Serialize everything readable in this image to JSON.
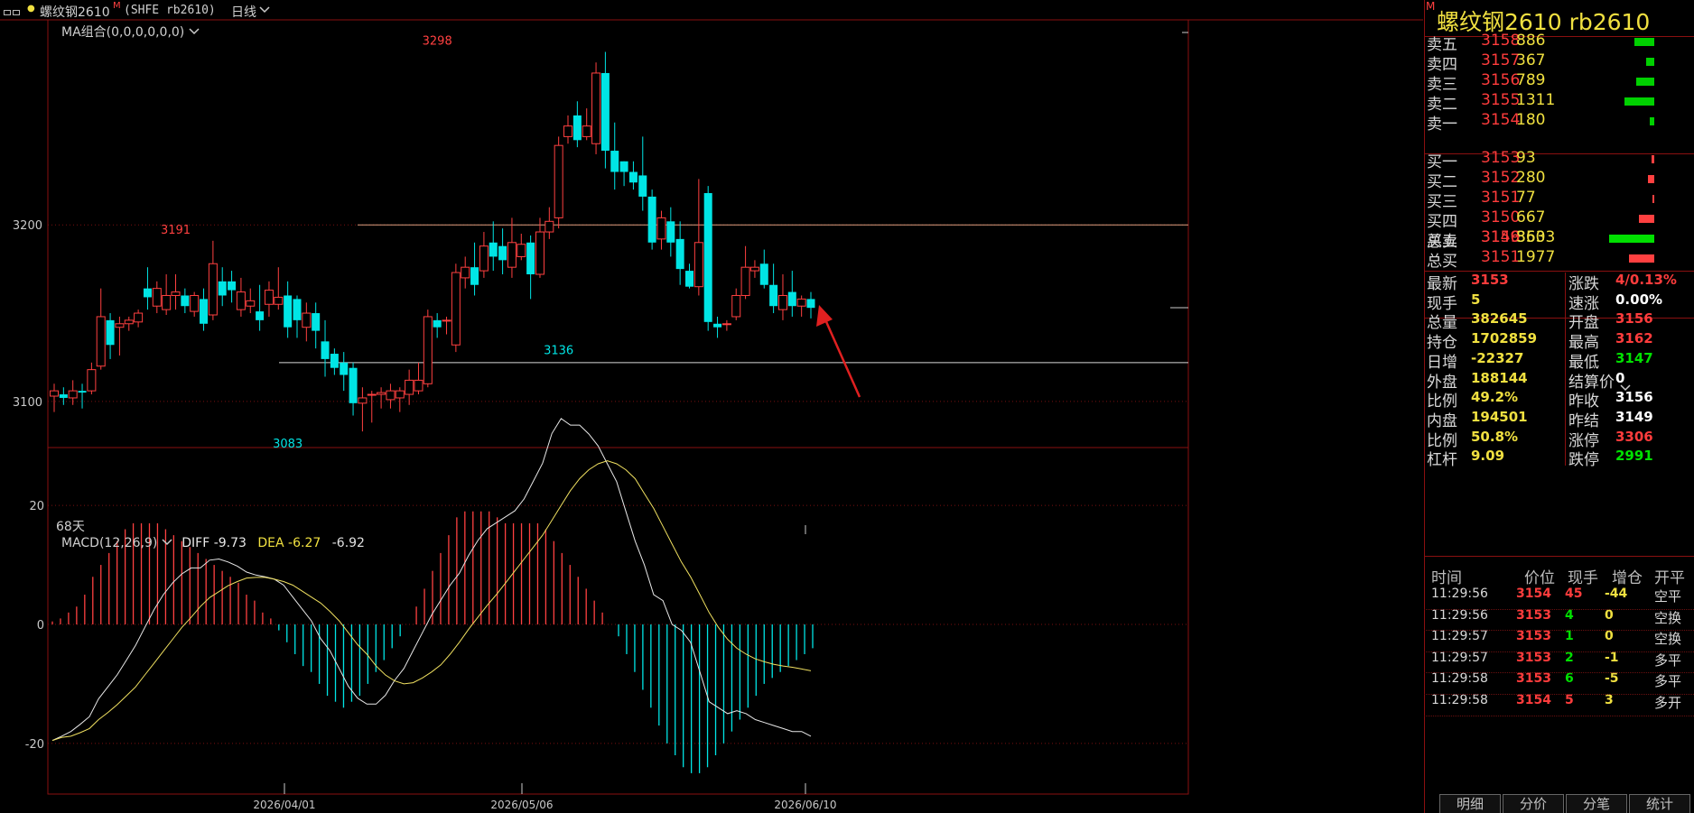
{
  "header": {
    "menu_icon": "window-menu-icon",
    "title": "螺纹钢2610",
    "title_marker": "M",
    "symbol": "(SHFE rb2610)",
    "period": "日线",
    "ma_label": "MA组合(0,0,0,0,0,0)",
    "days_label": "68天",
    "macd_label": "MACD(12,26,9)",
    "diff_label": "DIFF -9.73",
    "dea_label": "DEA -6.27",
    "macd_val": "-6.92",
    "colors": {
      "up": "#ff4040",
      "down": "#00e5e5",
      "bg": "#000000",
      "frame": "#8a1010"
    }
  },
  "chart_data": [
    {
      "type": "candlestick",
      "price_axis_ticks": [
        3100,
        3200
      ],
      "ylim": [
        3080,
        3310
      ],
      "x_axis_ticks": [
        "2026/04/01",
        "2026/05/06",
        "2026/06/10"
      ],
      "annotations": [
        {
          "label": "3191",
          "value": 3191,
          "candle_index": 13
        },
        {
          "label": "3298",
          "value": 3298,
          "candle_index": 41
        },
        {
          "label": "3083",
          "value": 3083,
          "candle_index": 25
        },
        {
          "label": "3136",
          "value": 3136,
          "candle_index": 54
        }
      ],
      "reference_lines": [
        3200,
        3122
      ],
      "candles": [
        [
          3103,
          3106,
          3094,
          3110
        ],
        [
          3104,
          3102,
          3098,
          3108
        ],
        [
          3102,
          3106,
          3098,
          3112
        ],
        [
          3106,
          3105,
          3096,
          3110
        ],
        [
          3106,
          3118,
          3104,
          3122
        ],
        [
          3120,
          3148,
          3118,
          3164
        ],
        [
          3146,
          3132,
          3124,
          3150
        ],
        [
          3142,
          3144,
          3126,
          3148
        ],
        [
          3144,
          3146,
          3140,
          3148
        ],
        [
          3145,
          3150,
          3142,
          3152
        ],
        [
          3164,
          3159,
          3152,
          3176
        ],
        [
          3154,
          3164,
          3150,
          3168
        ],
        [
          3152,
          3160,
          3149,
          3172
        ],
        [
          3160,
          3162,
          3152,
          3172
        ],
        [
          3160,
          3154,
          3150,
          3164
        ],
        [
          3151,
          3160,
          3148,
          3162
        ],
        [
          3158,
          3144,
          3140,
          3164
        ],
        [
          3149,
          3178,
          3146,
          3191
        ],
        [
          3168,
          3160,
          3154,
          3176
        ],
        [
          3168,
          3163,
          3156,
          3174
        ],
        [
          3152,
          3162,
          3148,
          3170
        ],
        [
          3154,
          3157,
          3150,
          3164
        ],
        [
          3151,
          3146,
          3140,
          3166
        ],
        [
          3155,
          3163,
          3148,
          3168
        ],
        [
          3155,
          3159,
          3152,
          3176
        ],
        [
          3160,
          3142,
          3136,
          3168
        ],
        [
          3158,
          3146,
          3136,
          3160
        ],
        [
          3142,
          3150,
          3134,
          3156
        ],
        [
          3150,
          3140,
          3130,
          3156
        ],
        [
          3134,
          3124,
          3114,
          3146
        ],
        [
          3127,
          3119,
          3115,
          3130
        ],
        [
          3122,
          3115,
          3106,
          3128
        ],
        [
          3119,
          3099,
          3092,
          3122
        ],
        [
          3099,
          3102,
          3083,
          3108
        ],
        [
          3104,
          3104,
          3088,
          3106
        ],
        [
          3104,
          3105,
          3096,
          3108
        ],
        [
          3101,
          3106,
          3096,
          3110
        ],
        [
          3102,
          3106,
          3094,
          3108
        ],
        [
          3104,
          3112,
          3098,
          3118
        ],
        [
          3106,
          3112,
          3104,
          3122
        ],
        [
          3110,
          3148,
          3108,
          3152
        ],
        [
          3146,
          3142,
          3136,
          3150
        ],
        [
          3146,
          3146,
          3138,
          3148
        ],
        [
          3132,
          3173,
          3128,
          3178
        ],
        [
          3170,
          3176,
          3164,
          3182
        ],
        [
          3176,
          3166,
          3160,
          3190
        ],
        [
          3174,
          3188,
          3170,
          3196
        ],
        [
          3190,
          3182,
          3174,
          3202
        ],
        [
          3188,
          3180,
          3172,
          3198
        ],
        [
          3176,
          3190,
          3170,
          3204
        ],
        [
          3182,
          3189,
          3180,
          3195
        ],
        [
          3190,
          3172,
          3158,
          3194
        ],
        [
          3172,
          3196,
          3170,
          3204
        ],
        [
          3196,
          3202,
          3192,
          3210
        ],
        [
          3204,
          3245,
          3198,
          3250
        ],
        [
          3250,
          3256,
          3246,
          3262
        ],
        [
          3262,
          3248,
          3244,
          3270
        ],
        [
          3250,
          3256,
          3248,
          3266
        ],
        [
          3246,
          3286,
          3240,
          3292
        ],
        [
          3286,
          3242,
          3232,
          3298
        ],
        [
          3242,
          3230,
          3220,
          3258
        ],
        [
          3236,
          3230,
          3222,
          3236
        ],
        [
          3230,
          3224,
          3220,
          3236
        ],
        [
          3228,
          3216,
          3208,
          3250
        ],
        [
          3216,
          3190,
          3186,
          3220
        ],
        [
          3192,
          3204,
          3186,
          3208
        ],
        [
          3202,
          3190,
          3182,
          3210
        ],
        [
          3192,
          3175,
          3166,
          3202
        ],
        [
          3174,
          3165,
          3164,
          3178
        ],
        [
          3165,
          3190,
          3160,
          3226
        ],
        [
          3218,
          3145,
          3140,
          3222
        ],
        [
          3144,
          3142,
          3136,
          3148
        ],
        [
          3144,
          3144,
          3140,
          3146
        ],
        [
          3148,
          3160,
          3146,
          3164
        ],
        [
          3160,
          3176,
          3158,
          3188
        ],
        [
          3174,
          3176,
          3170,
          3180
        ],
        [
          3178,
          3166,
          3164,
          3186
        ],
        [
          3166,
          3154,
          3150,
          3178
        ],
        [
          3152,
          3160,
          3146,
          3172
        ],
        [
          3162,
          3154,
          3148,
          3174
        ],
        [
          3154,
          3158,
          3148,
          3160
        ],
        [
          3158,
          3153,
          3147,
          3162
        ]
      ]
    },
    {
      "type": "macd",
      "ticks": [
        20,
        0,
        -20
      ],
      "ylim": [
        -27,
        27
      ],
      "diff": [
        -19.5,
        -18.8,
        -18,
        -16.8,
        -15.5,
        -12.5,
        -10.5,
        -8.5,
        -6,
        -3.5,
        -0.5,
        2.5,
        5,
        7,
        8.5,
        9.5,
        9.5,
        10.8,
        11,
        10.5,
        9.8,
        8.8,
        8.3,
        8,
        7.6,
        6.6,
        4.6,
        2.6,
        0.6,
        -2.4,
        -4.4,
        -7.4,
        -10.4,
        -12.4,
        -13.4,
        -13.4,
        -11.9,
        -9.4,
        -7.4,
        -4.4,
        -1.4,
        1.6,
        4.1,
        6.6,
        8.6,
        11.6,
        14.1,
        16.1,
        17.1,
        18.1,
        19.1,
        21.1,
        24.1,
        27.1,
        32.1,
        34.6,
        33.5,
        33.5,
        32,
        30,
        27,
        24,
        19,
        14,
        10,
        5,
        4,
        0,
        -1,
        -3,
        -8,
        -13,
        -14,
        -15,
        -14.5,
        -15,
        -16,
        -16.5,
        -17,
        -17.5,
        -18,
        -18,
        -18.8
      ],
      "dea": [
        -19.5,
        -19,
        -18.8,
        -18.2,
        -17.5,
        -16,
        -14.8,
        -13.5,
        -12,
        -10.5,
        -8.5,
        -6.5,
        -4.5,
        -2.5,
        -0.5,
        1.2,
        3,
        4.5,
        5.5,
        6.5,
        7.2,
        7.8,
        7.9,
        7.9,
        7.6,
        7.2,
        6.6,
        5.6,
        4.6,
        3.6,
        2.2,
        0.6,
        -1.4,
        -3.4,
        -5,
        -7,
        -8.5,
        -9.5,
        -10,
        -9.8,
        -9,
        -8,
        -6.8,
        -5,
        -3,
        -0.8,
        1.2,
        3.2,
        5,
        7,
        9,
        11,
        13,
        15,
        17.5,
        20,
        22.5,
        24.5,
        26,
        27,
        27.5,
        27,
        26,
        24.5,
        22,
        19.5,
        16.5,
        13.5,
        10.5,
        8,
        5,
        2,
        -0.5,
        -2.5,
        -4,
        -5,
        -5.8,
        -6.3,
        -6.7,
        -7,
        -7.2,
        -7.5,
        -7.8
      ],
      "hist": [
        0.5,
        1,
        2,
        3,
        5,
        8,
        10,
        12,
        14,
        16,
        17,
        17,
        17,
        17,
        16,
        15,
        14,
        13,
        12,
        11,
        10,
        9,
        8,
        7,
        5,
        4,
        2,
        1,
        -1,
        -3,
        -5,
        -7,
        -8,
        -10,
        -12,
        -13,
        -14,
        -13,
        -12,
        -10,
        -8,
        -6,
        -4,
        -2,
        0,
        3,
        6,
        9,
        12,
        15,
        18,
        19,
        19,
        19,
        19,
        18,
        17,
        17,
        17,
        17,
        17,
        16,
        14,
        12,
        10,
        8,
        6,
        4,
        2,
        0,
        -2,
        -5,
        -8,
        -11,
        -14,
        -17,
        -20,
        -22,
        -24,
        -25,
        -25,
        -24,
        -22,
        -20,
        -18,
        -16,
        -14,
        -12,
        -10,
        -9,
        -8,
        -7,
        -6,
        -5,
        -4
      ]
    }
  ],
  "quote": {
    "title": "螺纹钢2610  rb2610",
    "title_marker": "M",
    "asks": [
      {
        "label": "卖五",
        "price": "3158",
        "vol": "886",
        "bar": 0.44
      },
      {
        "label": "卖四",
        "price": "3157",
        "vol": "367",
        "bar": 0.18
      },
      {
        "label": "卖三",
        "price": "3156",
        "vol": "789",
        "bar": 0.39
      },
      {
        "label": "卖二",
        "price": "3155",
        "vol": "1311",
        "bar": 0.65
      },
      {
        "label": "卖一",
        "price": "3154",
        "vol": "180",
        "bar": 0.09
      }
    ],
    "bids": [
      {
        "label": "买一",
        "price": "3153",
        "vol": "93",
        "bar": 0.05
      },
      {
        "label": "买二",
        "price": "3152",
        "vol": "280",
        "bar": 0.14
      },
      {
        "label": "买三",
        "price": "3151",
        "vol": "77",
        "bar": 0.04
      },
      {
        "label": "买四",
        "price": "3150",
        "vol": "667",
        "bar": 0.33
      },
      {
        "label": "买五",
        "price": "3149",
        "vol": "860",
        "bar": 0.43
      }
    ],
    "totals": [
      {
        "label": "总卖",
        "price": "3156",
        "vol": "3533",
        "bar": 1.0,
        "color": "#00e000"
      },
      {
        "label": "总买",
        "price": "3151",
        "vol": "1977",
        "bar": 0.56,
        "color": "#ff4040"
      }
    ],
    "stats": [
      {
        "l1": "最新",
        "v1": "3153",
        "c1": "red",
        "l2": "涨跌",
        "v2": "4/0.13%",
        "c2": "red"
      },
      {
        "l1": "现手",
        "v1": "5",
        "c1": "yel",
        "l2": "速涨",
        "v2": "0.00%",
        "c2": "wht"
      },
      {
        "l1": "总量",
        "v1": "382645",
        "c1": "yel",
        "l2": "开盘",
        "v2": "3156",
        "c2": "red"
      },
      {
        "l1": "持仓",
        "v1": "1702859",
        "c1": "yel",
        "l2": "最高",
        "v2": "3162",
        "c2": "red"
      },
      {
        "l1": "日增",
        "v1": "-22327",
        "c1": "yel",
        "l2": "最低",
        "v2": "3147",
        "c2": "grn"
      },
      {
        "l1": "外盘",
        "v1": "188144",
        "c1": "yel",
        "l2": "结算价",
        "v2": "0",
        "c2": "wht"
      },
      {
        "l1": "比例",
        "v1": "49.2%",
        "c1": "yel",
        "l2": "昨收",
        "v2": "3156",
        "c2": "wht"
      },
      {
        "l1": "内盘",
        "v1": "194501",
        "c1": "yel",
        "l2": "昨结",
        "v2": "3149",
        "c2": "wht"
      },
      {
        "l1": "比例",
        "v1": "50.8%",
        "c1": "yel",
        "l2": "涨停",
        "v2": "3306",
        "c2": "red"
      },
      {
        "l1": "杠杆",
        "v1": "9.09",
        "c1": "yel",
        "l2": "跌停",
        "v2": "2991",
        "c2": "grn"
      }
    ],
    "ticks_header": {
      "time": "时间",
      "price": "价位",
      "hand": "现手",
      "oi": "增仓",
      "type": "开平"
    },
    "ticks": [
      {
        "time": "11:29:56",
        "price": "3154",
        "hand": "45",
        "hand_c": "red",
        "oi": "-44",
        "type": "空平"
      },
      {
        "time": "11:29:56",
        "price": "3153",
        "hand": "4",
        "hand_c": "grn",
        "oi": "0",
        "type": "空换"
      },
      {
        "time": "11:29:57",
        "price": "3153",
        "hand": "1",
        "hand_c": "grn",
        "oi": "0",
        "type": "空换"
      },
      {
        "time": "11:29:57",
        "price": "3153",
        "hand": "2",
        "hand_c": "grn",
        "oi": "-1",
        "type": "多平"
      },
      {
        "time": "11:29:58",
        "price": "3153",
        "hand": "6",
        "hand_c": "grn",
        "oi": "-5",
        "type": "多平"
      },
      {
        "time": "11:29:58",
        "price": "3154",
        "hand": "5",
        "hand_c": "red",
        "oi": "3",
        "type": "多开"
      }
    ],
    "tabs": [
      "明细",
      "分价",
      "分笔",
      "统计"
    ]
  }
}
